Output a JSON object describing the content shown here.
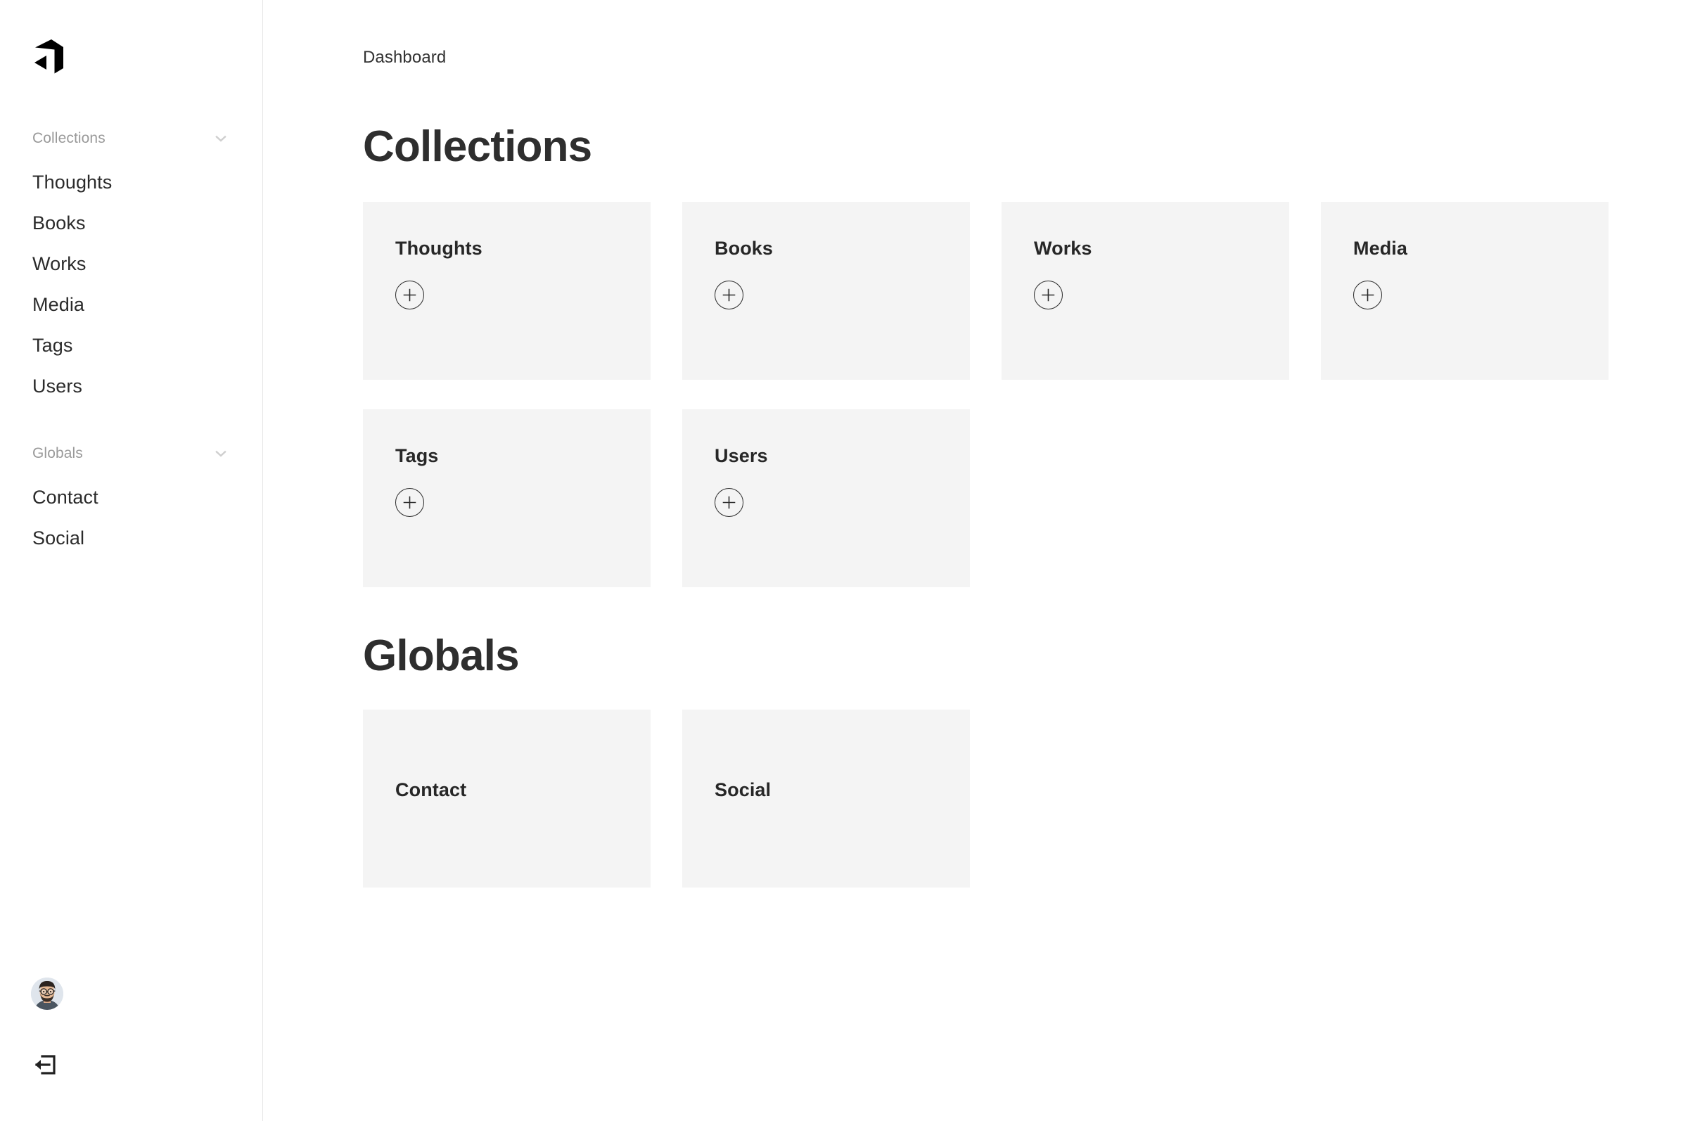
{
  "brand": {
    "logo_icon": "payload-logo-icon",
    "logo_alt": "Payload"
  },
  "sidebar": {
    "groups": [
      {
        "label": "Collections",
        "toggle_icon": "chevron-down-icon",
        "items": [
          {
            "label": "Thoughts"
          },
          {
            "label": "Books"
          },
          {
            "label": "Works"
          },
          {
            "label": "Media"
          },
          {
            "label": "Tags"
          },
          {
            "label": "Users"
          }
        ]
      },
      {
        "label": "Globals",
        "toggle_icon": "chevron-down-icon",
        "items": [
          {
            "label": "Contact"
          },
          {
            "label": "Social"
          }
        ]
      }
    ],
    "footer": {
      "avatar_icon": "user-avatar",
      "logout_icon": "log-out-icon"
    }
  },
  "main": {
    "breadcrumb": "Dashboard",
    "sections": [
      {
        "title": "Collections",
        "cards": [
          {
            "title": "Thoughts",
            "add_icon": "plus-icon"
          },
          {
            "title": "Books",
            "add_icon": "plus-icon"
          },
          {
            "title": "Works",
            "add_icon": "plus-icon"
          },
          {
            "title": "Media",
            "add_icon": "plus-icon"
          },
          {
            "title": "Tags",
            "add_icon": "plus-icon"
          },
          {
            "title": "Users",
            "add_icon": "plus-icon"
          }
        ]
      },
      {
        "title": "Globals",
        "cards": [
          {
            "title": "Contact"
          },
          {
            "title": "Social"
          }
        ]
      }
    ]
  },
  "colors": {
    "card_bg": "#f4f4f4",
    "text": "#2b2b2b",
    "muted": "#9a9a9a",
    "border": "#e6e6e6",
    "accent": "#000000"
  }
}
